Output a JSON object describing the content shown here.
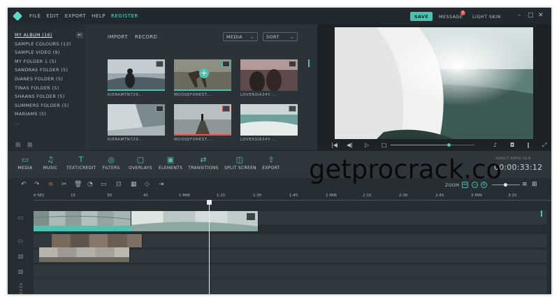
{
  "menu": {
    "file": "FILE",
    "edit": "EDIT",
    "export": "EXPORT",
    "help": "HELP",
    "register": "REGISTER"
  },
  "header": {
    "save": "SAVE",
    "messages": "MESSAGE",
    "message_count": "1",
    "light_skin": "LIGHT SKIN"
  },
  "sidebar": {
    "items": [
      "MY ALBUM (16)",
      "SAMPLE COLOURS (13)",
      "SAMPLE VIDEO (9)",
      "MY FOLDER 1 (5)",
      "SANDRAS FOLDER (5)",
      "DIANES FOLDER (5)",
      "TINAS FOLDER (5)",
      "SHAANS FOLDER (5)",
      "SUMMERS FOLDER (5)",
      "MARIAMS (5)",
      "..."
    ],
    "collapse_icon": "arrow-left-icon"
  },
  "library": {
    "import": "IMPORT",
    "record": "RECORD",
    "media": "MEDIA",
    "sort": "SORT",
    "thumbnails": [
      {
        "label": "KIERAMTN729...",
        "kind": "video"
      },
      {
        "label": "MOOSEFOREST....",
        "kind": "video"
      },
      {
        "label": "LOVERSIA34Y....",
        "kind": "video"
      },
      {
        "label": "KIERAMTN729...",
        "kind": "video"
      },
      {
        "label": "MOOSEFOREST....",
        "kind": "music"
      },
      {
        "label": "LOVERSIA34Y....",
        "kind": "video"
      }
    ]
  },
  "toolbar": {
    "tools": [
      {
        "label": "MEDIA",
        "icon": "folder-icon"
      },
      {
        "label": "MUSIC",
        "icon": "music-note-icon"
      },
      {
        "label": "TEXT/CREDIT",
        "icon": "text-icon"
      },
      {
        "label": "FILTERS",
        "icon": "filters-icon"
      },
      {
        "label": "OVERLAYS",
        "icon": "overlay-icon"
      },
      {
        "label": "ELEMENTS",
        "icon": "image-icon"
      },
      {
        "label": "TRANSITIONS",
        "icon": "transition-icon"
      },
      {
        "label": "SPLIT SCREEN",
        "icon": "split-screen-icon"
      },
      {
        "label": "EXPORT",
        "icon": "export-icon"
      }
    ],
    "aspect_ratio": "ASPECT RATIO 16:9",
    "timecode": "00:00:33:12"
  },
  "timeline": {
    "zoom": "ZOOM",
    "ruler": [
      "0 SEC",
      "15",
      "30",
      "45",
      "1 MIN",
      "1:15",
      "1:30",
      "1:45",
      "2 MIN",
      "2:15",
      "2:30",
      "2:45",
      "3 MIN",
      "3:15"
    ]
  },
  "watermark": "getprocrack.co",
  "colors": {
    "accent": "#4ec2b0",
    "alert": "#e0584c",
    "background": "#262d33"
  }
}
